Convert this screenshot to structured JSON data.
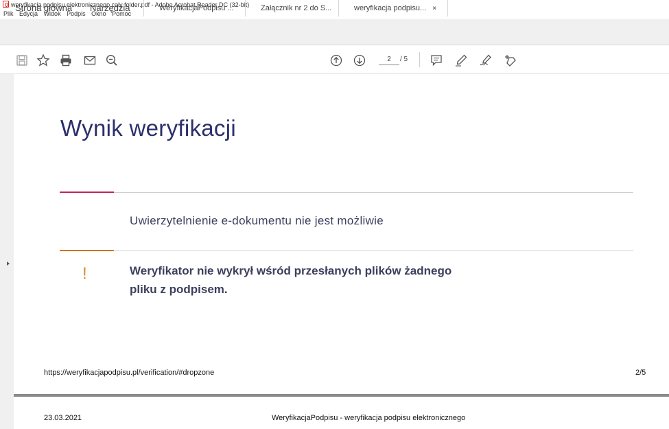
{
  "window": {
    "title": "weryfikacja podpisu elektronicznego cały folder.pdf - Adobe Acrobat Reader DC (32-bit)"
  },
  "menu": [
    "Plik",
    "Edycja",
    "Widok",
    "Podpis",
    "Okno",
    "Pomoc"
  ],
  "tabs": {
    "home": "Strona główna",
    "tools": "Narzędzia",
    "docs": [
      {
        "label": "WeryfikacjaPodpisu ..."
      },
      {
        "label": "Załącznik nr 2 do S..."
      },
      {
        "label": "weryfikacja podpisu...",
        "close": "×",
        "active": true
      }
    ]
  },
  "toolbar": {
    "icons": [
      "save-icon",
      "bookmark-star-icon",
      "print-icon",
      "email-icon",
      "zoom-out-icon",
      "page-up-icon",
      "page-down-icon",
      "comment-icon",
      "highlight-pen-icon",
      "sign-icon",
      "fill-sign-icon"
    ],
    "page_current": "2",
    "page_total": "/ 5"
  },
  "document": {
    "title": "Wynik weryfikacji",
    "status": "Uwierzytelnienie e-dokumentu nie jest możliwie",
    "warning_mark": "!",
    "warning_line1": "Weryfikator nie wykrył wśród przesłanych plików żadnego",
    "warning_line2": "pliku z podpisem.",
    "footer_url": "https://weryfikacjapodpisu.pl/verification/#dropzone",
    "footer_page": "2/5",
    "next_page_date": "23.03.2021",
    "next_page_header": "WeryfikacjaPodpisu - weryfikacja podpisu elektronicznego"
  },
  "colors": {
    "title": "#2b2f6b",
    "accent_red": "#c0245a",
    "accent_orange": "#c8761e",
    "warning": "#d4892a"
  }
}
